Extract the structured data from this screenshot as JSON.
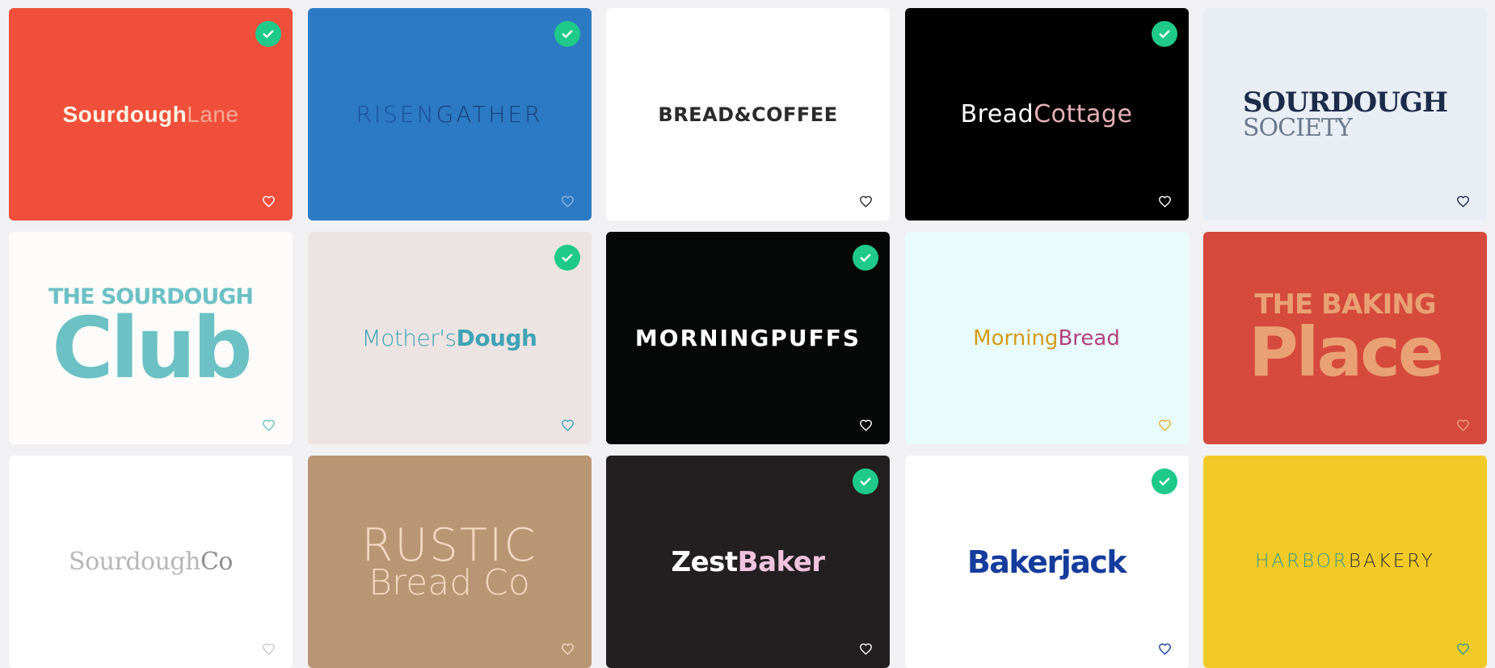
{
  "cards": [
    {
      "id": "sourdough-lane",
      "bg": "#f04f3b",
      "checked": true,
      "heart_color": "#ffffff",
      "logo": {
        "a": "Sourdough",
        "b": "Lane"
      }
    },
    {
      "id": "risengather",
      "bg": "#2c7ac3",
      "checked": true,
      "heart_color": "#8fb6e0",
      "logo": {
        "a": "RISEN",
        "b": "GATHER"
      }
    },
    {
      "id": "bread-coffee",
      "bg": "#ffffff",
      "checked": false,
      "heart_color": "#2b2b2b",
      "logo": {
        "a": "BREAD&COFFEE"
      }
    },
    {
      "id": "bread-cottage",
      "bg": "#000000",
      "checked": true,
      "heart_color": "#ffffff",
      "logo": {
        "a": "Bread",
        "b": "Cottage"
      }
    },
    {
      "id": "sourdough-society",
      "bg": "#e9eef4",
      "checked": false,
      "heart_color": "#1c2b4b",
      "logo": {
        "a": "SOURDOUGH",
        "b": "SOCIETY"
      }
    },
    {
      "id": "sourdough-club",
      "bg": "#fdfcfa",
      "checked": false,
      "heart_color": "#6cc1c4",
      "logo": {
        "a": "THE SOURDOUGH",
        "b": "Club"
      }
    },
    {
      "id": "mothers-dough",
      "bg": "#ece4e2",
      "checked": true,
      "heart_color": "#3fa3b5",
      "logo": {
        "a": "Mother's",
        "b": "Dough"
      }
    },
    {
      "id": "morningpuffs",
      "bg": "#060707",
      "checked": true,
      "heart_color": "#ffffff",
      "logo": {
        "a": "MORNINGPUFFS"
      }
    },
    {
      "id": "morning-bread",
      "bg": "#e8fdfb",
      "checked": false,
      "heart_color": "#e3b12d",
      "logo": {
        "a": "Morning",
        "b": "Bread"
      }
    },
    {
      "id": "baking-place",
      "bg": "#d54a3d",
      "checked": false,
      "heart_color": "#eba081",
      "logo": {
        "a": "THE BAKING",
        "b": "Place"
      }
    },
    {
      "id": "sourdough-co",
      "bg": "#ffffff",
      "checked": false,
      "heart_color": "#c9c9c9",
      "logo": {
        "a": "Sourdough",
        "b": "Co"
      }
    },
    {
      "id": "rustic-bread",
      "bg": "#b99673",
      "checked": false,
      "heart_color": "#f3d7c2",
      "logo": {
        "a": "RUSTIC",
        "b": "Bread Co"
      }
    },
    {
      "id": "zestbaker",
      "bg": "#231f20",
      "checked": true,
      "heart_color": "#ffffff",
      "logo": {
        "a": "Zest",
        "b": "Baker"
      }
    },
    {
      "id": "bakerjack",
      "bg": "#ffffff",
      "checked": true,
      "heart_color": "#153c9c",
      "logo": {
        "a": "Bakerjack"
      }
    },
    {
      "id": "harbor-bakery",
      "bg": "#f2ca27",
      "checked": false,
      "heart_color": "#2b9a8a",
      "logo": {
        "a": "HARBOR",
        "b": "BAKERY"
      }
    }
  ],
  "icons": {
    "check": "check-icon",
    "heart": "heart-outline-icon"
  },
  "colors": {
    "page_bg": "#f1f1f3",
    "check_badge": "#1ec98a"
  }
}
